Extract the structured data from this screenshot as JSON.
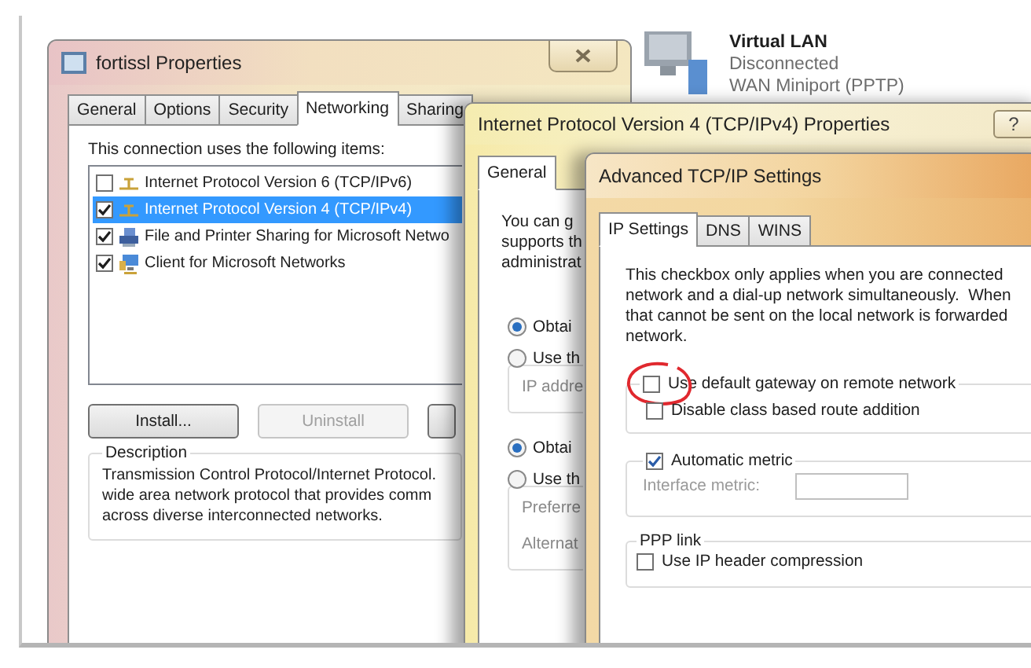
{
  "connection_properties": {
    "title": "fortissl Properties",
    "tabs": [
      {
        "label": "General",
        "selected": false
      },
      {
        "label": "Options",
        "selected": false
      },
      {
        "label": "Security",
        "selected": false
      },
      {
        "label": "Networking",
        "selected": true
      },
      {
        "label": "Sharing",
        "selected": false
      }
    ],
    "items_label": "This connection uses the following items:",
    "items": [
      {
        "label": "Internet Protocol Version 6 (TCP/IPv6)",
        "checked": false,
        "selected": false,
        "kind": "protocol"
      },
      {
        "label": "Internet Protocol Version 4 (TCP/IPv4)",
        "checked": true,
        "selected": true,
        "kind": "protocol"
      },
      {
        "label": "File and Printer Sharing for Microsoft Netwo",
        "checked": true,
        "selected": false,
        "kind": "service"
      },
      {
        "label": "Client for Microsoft Networks",
        "checked": true,
        "selected": false,
        "kind": "client"
      }
    ],
    "buttons": [
      {
        "label": "Install...",
        "disabled": false
      },
      {
        "label": "Uninstall",
        "disabled": true
      },
      {
        "disabled": false
      }
    ],
    "description": {
      "title": "Description",
      "lines": [
        "Transmission Control Protocol/Internet Protocol.",
        "wide area network protocol that provides comm",
        "across diverse interconnected networks."
      ]
    }
  },
  "network_list": {
    "name": "Virtual LAN",
    "status": "Disconnected",
    "device": "WAN Miniport (PPTP)"
  },
  "ipv4_properties": {
    "title": "Internet Protocol Version 4 (TCP/IPv4) Properties",
    "help": "?",
    "tabs": [
      {
        "label": "General",
        "selected": true
      }
    ],
    "intro_lines": [
      "You can g",
      "supports th",
      "administrat"
    ],
    "sections": [
      {
        "radios": [
          {
            "label": "Obtai",
            "selected": true
          },
          {
            "label": "Use th",
            "selected": false
          }
        ],
        "fields": [
          "IP addre"
        ]
      },
      {
        "radios": [
          {
            "label": "Obtai",
            "selected": true
          },
          {
            "label": "Use th",
            "selected": false
          }
        ],
        "fields": [
          "Preferre",
          "Alternat"
        ]
      }
    ]
  },
  "advanced": {
    "title": "Advanced TCP/IP Settings",
    "tabs": [
      {
        "label": "IP Settings",
        "selected": true
      },
      {
        "label": "DNS",
        "selected": false
      },
      {
        "label": "WINS",
        "selected": false
      }
    ],
    "note_lines": [
      "This checkbox only applies when you are connected",
      "network and a dial-up network simultaneously.  When",
      "that cannot be sent on the local network is forwarded",
      "network."
    ],
    "gateway_options": [
      {
        "label": "Use default gateway on remote network",
        "checked": false,
        "circled": true
      },
      {
        "label": "Disable class based route addition",
        "checked": false,
        "circled": false
      }
    ],
    "metric": {
      "label": "Automatic metric",
      "checked": true,
      "field_label": "Interface metric:"
    },
    "ppp": {
      "title": "PPP link",
      "options": [
        {
          "label": "Use IP header compression",
          "checked": false
        }
      ]
    }
  }
}
